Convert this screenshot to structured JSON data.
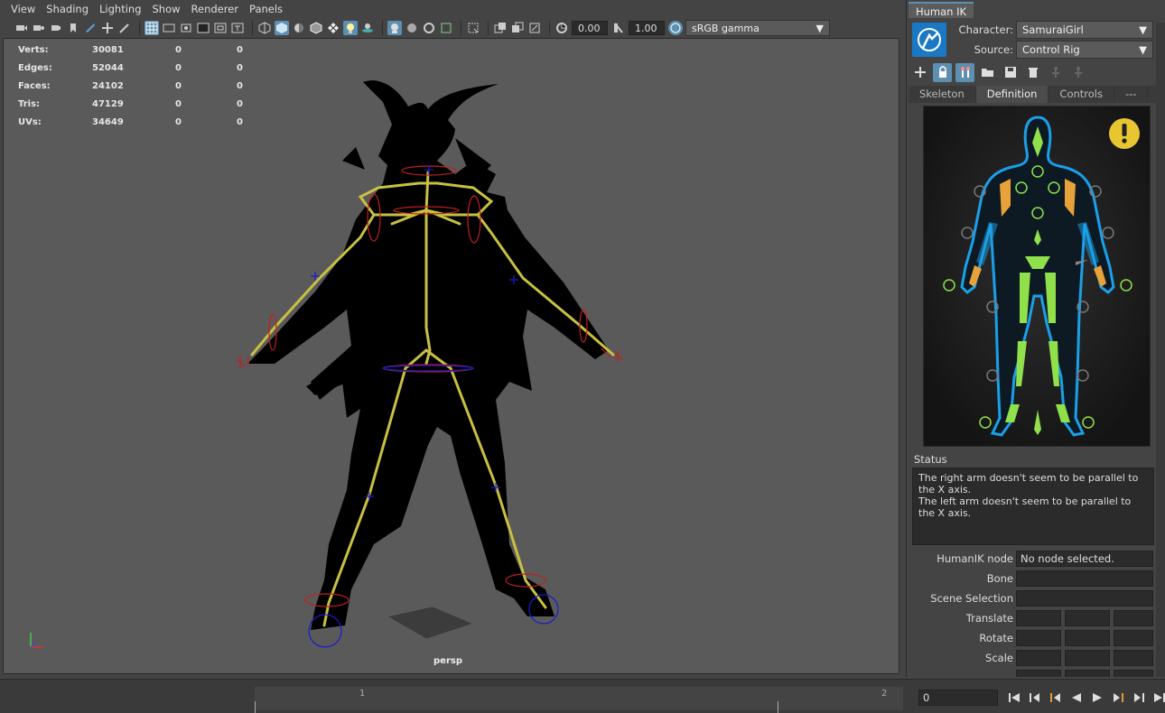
{
  "viewport": {
    "menu": [
      "View",
      "Shading",
      "Lighting",
      "Show",
      "Renderer",
      "Panels"
    ],
    "exposure_value": "0.00",
    "gamma_value": "1.00",
    "color_space": "sRGB gamma",
    "camera_label": "persp",
    "hud": [
      {
        "label": "Verts:",
        "value": "30081",
        "a": "0",
        "b": "0"
      },
      {
        "label": "Edges:",
        "value": "52044",
        "a": "0",
        "b": "0"
      },
      {
        "label": "Faces:",
        "value": "24102",
        "a": "0",
        "b": "0"
      },
      {
        "label": "Tris:",
        "value": "47129",
        "a": "0",
        "b": "0"
      },
      {
        "label": "UVs:",
        "value": "34649",
        "a": "0",
        "b": "0"
      }
    ]
  },
  "human_ik": {
    "tab": "Human IK",
    "character_label": "Character:",
    "character_value": "SamuraiGirl",
    "source_label": "Source:",
    "source_value": "Control Rig",
    "tabs": [
      "Skeleton",
      "Definition",
      "Controls",
      "---"
    ],
    "active_tab": "Definition",
    "status_label": "Status",
    "status_lines": [
      "The right arm doesn't seem to be parallel to the X axis.",
      "The left arm doesn't seem to be parallel to the X axis."
    ],
    "props": {
      "node_label": "HumanIK node",
      "node_value": "No node selected.",
      "bone_label": "Bone",
      "scene_selection_label": "Scene Selection",
      "translate_label": "Translate",
      "rotate_label": "Rotate",
      "scale_label": "Scale"
    },
    "colors": {
      "accent": "#5d8fb0",
      "limb_green": "#8fe04a",
      "limb_orange": "#e8a23a",
      "outline_blue": "#1aa0e8",
      "warning": "#e8c632"
    }
  },
  "timeline": {
    "marker_1": "1",
    "marker_2": "2",
    "current_frame": "0"
  }
}
